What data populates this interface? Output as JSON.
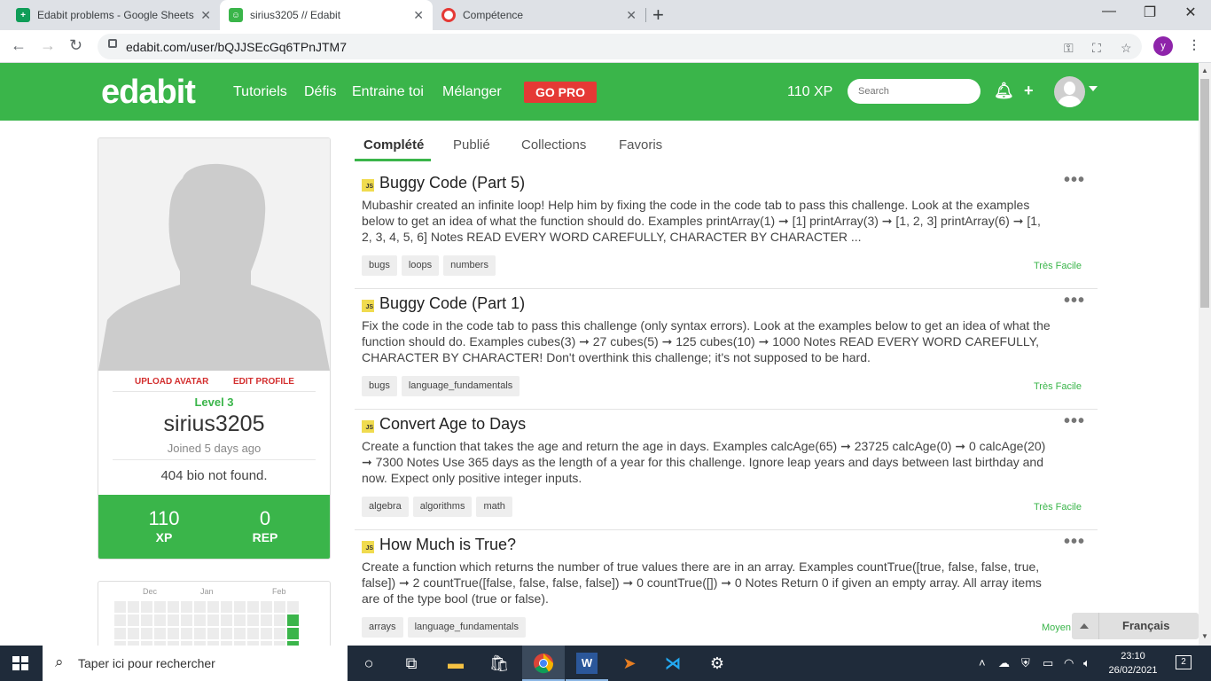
{
  "browser": {
    "tabs": [
      {
        "title": "Edabit problems - Google Sheets",
        "icon": "sheets-icon",
        "color": "#0f9d58"
      },
      {
        "title": "sirius3205 // Edabit",
        "icon": "edabit-icon",
        "color": "#3ab54a"
      },
      {
        "title": "Compétence",
        "icon": "opera-icon",
        "color": "#e53935"
      }
    ],
    "url": "edabit.com/user/bQJJSEcGq6TPnJTM7",
    "profile_initial": "y"
  },
  "header": {
    "logo": "edabit",
    "nav": [
      "Tutoriels",
      "Défis",
      "Entraine toi",
      "Mélanger"
    ],
    "gopro": "GO PRO",
    "xp": "110 XP",
    "search_placeholder": "Search",
    "accent": "#3ab54a"
  },
  "profile": {
    "upload_avatar": "UPLOAD AVATAR",
    "edit_profile": "EDIT PROFILE",
    "level": "Level 3",
    "username": "sirius3205",
    "joined": "Joined 5 days ago",
    "bio": "404 bio not found.",
    "xp_value": "110",
    "xp_label": "XP",
    "rep_value": "0",
    "rep_label": "REP",
    "calendar_months": [
      "Dec",
      "Jan",
      "Feb"
    ]
  },
  "tabs": [
    "Complété",
    "Publié",
    "Collections",
    "Favoris"
  ],
  "challenges": [
    {
      "title": "Buggy Code (Part 5)",
      "desc": "Mubashir created an infinite loop! Help him by fixing the code in the code tab to pass this challenge. Look at the examples below to get an idea of what the function should do. Examples printArray(1) ➞ [1] printArray(3) ➞ [1, 2, 3] printArray(6) ➞ [1, 2, 3, 4, 5, 6] Notes READ EVERY WORD CAREFULLY, CHARACTER BY CHARACTER ...",
      "tags": [
        "bugs",
        "loops",
        "numbers"
      ],
      "difficulty": "Très Facile"
    },
    {
      "title": "Buggy Code (Part 1)",
      "desc": "Fix the code in the code tab to pass this challenge (only syntax errors). Look at the examples below to get an idea of what the function should do. Examples cubes(3) ➞ 27 cubes(5) ➞ 125 cubes(10) ➞ 1000 Notes READ EVERY WORD CAREFULLY, CHARACTER BY CHARACTER! Don't overthink this challenge; it's not supposed to be hard.",
      "tags": [
        "bugs",
        "language_fundamentals"
      ],
      "difficulty": "Très Facile"
    },
    {
      "title": "Convert Age to Days",
      "desc": "Create a function that takes the age and return the age in days. Examples calcAge(65) ➞ 23725 calcAge(0) ➞ 0 calcAge(20) ➞ 7300 Notes Use 365 days as the length of a year for this challenge. Ignore leap years and days between last birthday and now. Expect only positive integer inputs.",
      "tags": [
        "algebra",
        "algorithms",
        "math"
      ],
      "difficulty": "Très Facile"
    },
    {
      "title": "How Much is True?",
      "desc": "Create a function which returns the number of true values there are in an array. Examples countTrue([true, false, false, true, false]) ➞ 2 countTrue([false, false, false, false]) ➞ 0 countTrue([]) ➞ 0 Notes Return 0 if given an empty array. All array items are of the type bool (true or false).",
      "tags": [
        "arrays",
        "language_fundamentals"
      ],
      "difficulty": "Moyen"
    }
  ],
  "language": "Français",
  "taskbar": {
    "search_placeholder": "Taper ici pour rechercher",
    "time": "23:10",
    "date": "26/02/2021",
    "notifications": "2"
  }
}
